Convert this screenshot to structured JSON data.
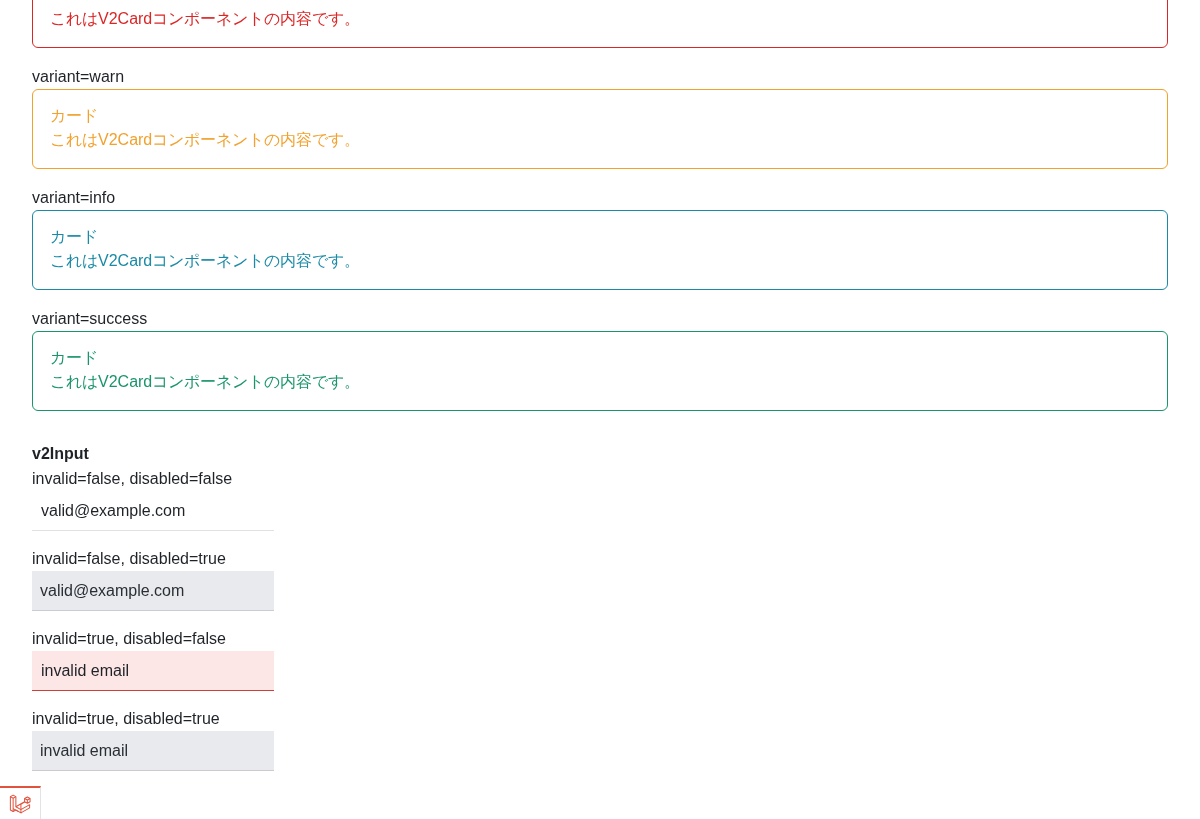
{
  "cards": {
    "items": [
      {
        "body": "これはV2Cardコンポーネントの内容です。",
        "color": "#dc2626"
      },
      {
        "label": "variant=warn",
        "title": "カード",
        "body": "これはV2Cardコンポーネントの内容です。",
        "color": "#f2a12c"
      },
      {
        "label": "variant=info",
        "title": "カード",
        "body": "これはV2Cardコンポーネントの内容です。",
        "color": "#1a8aa6"
      },
      {
        "label": "variant=success",
        "title": "カード",
        "body": "これはV2Cardコンポーネントの内容です。",
        "color": "#1a956b"
      }
    ]
  },
  "inputs": {
    "heading": "v2Input",
    "fields": [
      {
        "label": "invalid=false, disabled=false",
        "value": "valid@example.com",
        "invalid": false,
        "disabled": false
      },
      {
        "label": "invalid=false, disabled=true",
        "value": "valid@example.com",
        "invalid": false,
        "disabled": true
      },
      {
        "label": "invalid=true, disabled=false",
        "value": "invalid email",
        "invalid": true,
        "disabled": false
      },
      {
        "label": "invalid=true, disabled=true",
        "value": "invalid email",
        "invalid": true,
        "disabled": true
      }
    ]
  }
}
